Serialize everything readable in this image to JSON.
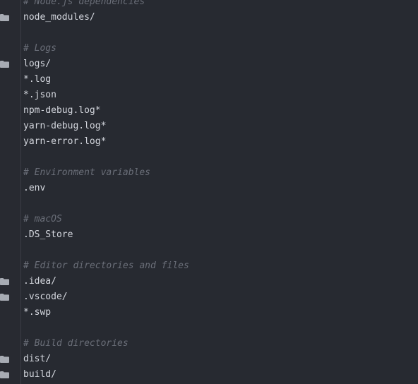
{
  "editor": {
    "lines": [
      {
        "text": "# Node.js dependencies",
        "kind": "comment",
        "icon": ""
      },
      {
        "text": "node_modules/",
        "kind": "code",
        "icon": "folder-icon"
      },
      {
        "text": "",
        "kind": "blank",
        "icon": ""
      },
      {
        "text": "# Logs",
        "kind": "comment",
        "icon": ""
      },
      {
        "text": "logs/",
        "kind": "code",
        "icon": "folder-icon"
      },
      {
        "text": "*.log",
        "kind": "code",
        "icon": ""
      },
      {
        "text": "*.json",
        "kind": "code",
        "icon": ""
      },
      {
        "text": "npm-debug.log*",
        "kind": "code",
        "icon": ""
      },
      {
        "text": "yarn-debug.log*",
        "kind": "code",
        "icon": ""
      },
      {
        "text": "yarn-error.log*",
        "kind": "code",
        "icon": ""
      },
      {
        "text": "",
        "kind": "blank",
        "icon": ""
      },
      {
        "text": "# Environment variables",
        "kind": "comment",
        "icon": ""
      },
      {
        "text": ".env",
        "kind": "code",
        "icon": ""
      },
      {
        "text": "",
        "kind": "blank",
        "icon": ""
      },
      {
        "text": "# macOS",
        "kind": "comment",
        "icon": ""
      },
      {
        "text": ".DS_Store",
        "kind": "code",
        "icon": ""
      },
      {
        "text": "",
        "kind": "blank",
        "icon": ""
      },
      {
        "text": "# Editor directories and files",
        "kind": "comment",
        "icon": ""
      },
      {
        "text": ".idea/",
        "kind": "code",
        "icon": "folder-icon"
      },
      {
        "text": ".vscode/",
        "kind": "code",
        "icon": "folder-icon"
      },
      {
        "text": "*.swp",
        "kind": "code",
        "icon": ""
      },
      {
        "text": "",
        "kind": "blank",
        "icon": ""
      },
      {
        "text": "# Build directories",
        "kind": "comment",
        "icon": ""
      },
      {
        "text": "dist/",
        "kind": "code",
        "icon": "folder-icon"
      },
      {
        "text": "build/",
        "kind": "code",
        "icon": "folder-icon"
      }
    ]
  },
  "colors": {
    "background": "#272a31",
    "gutter": "#282a31",
    "code_text": "#d4d7de",
    "comment_text": "#6a6e78",
    "folder_icon": "#a7abb3"
  }
}
